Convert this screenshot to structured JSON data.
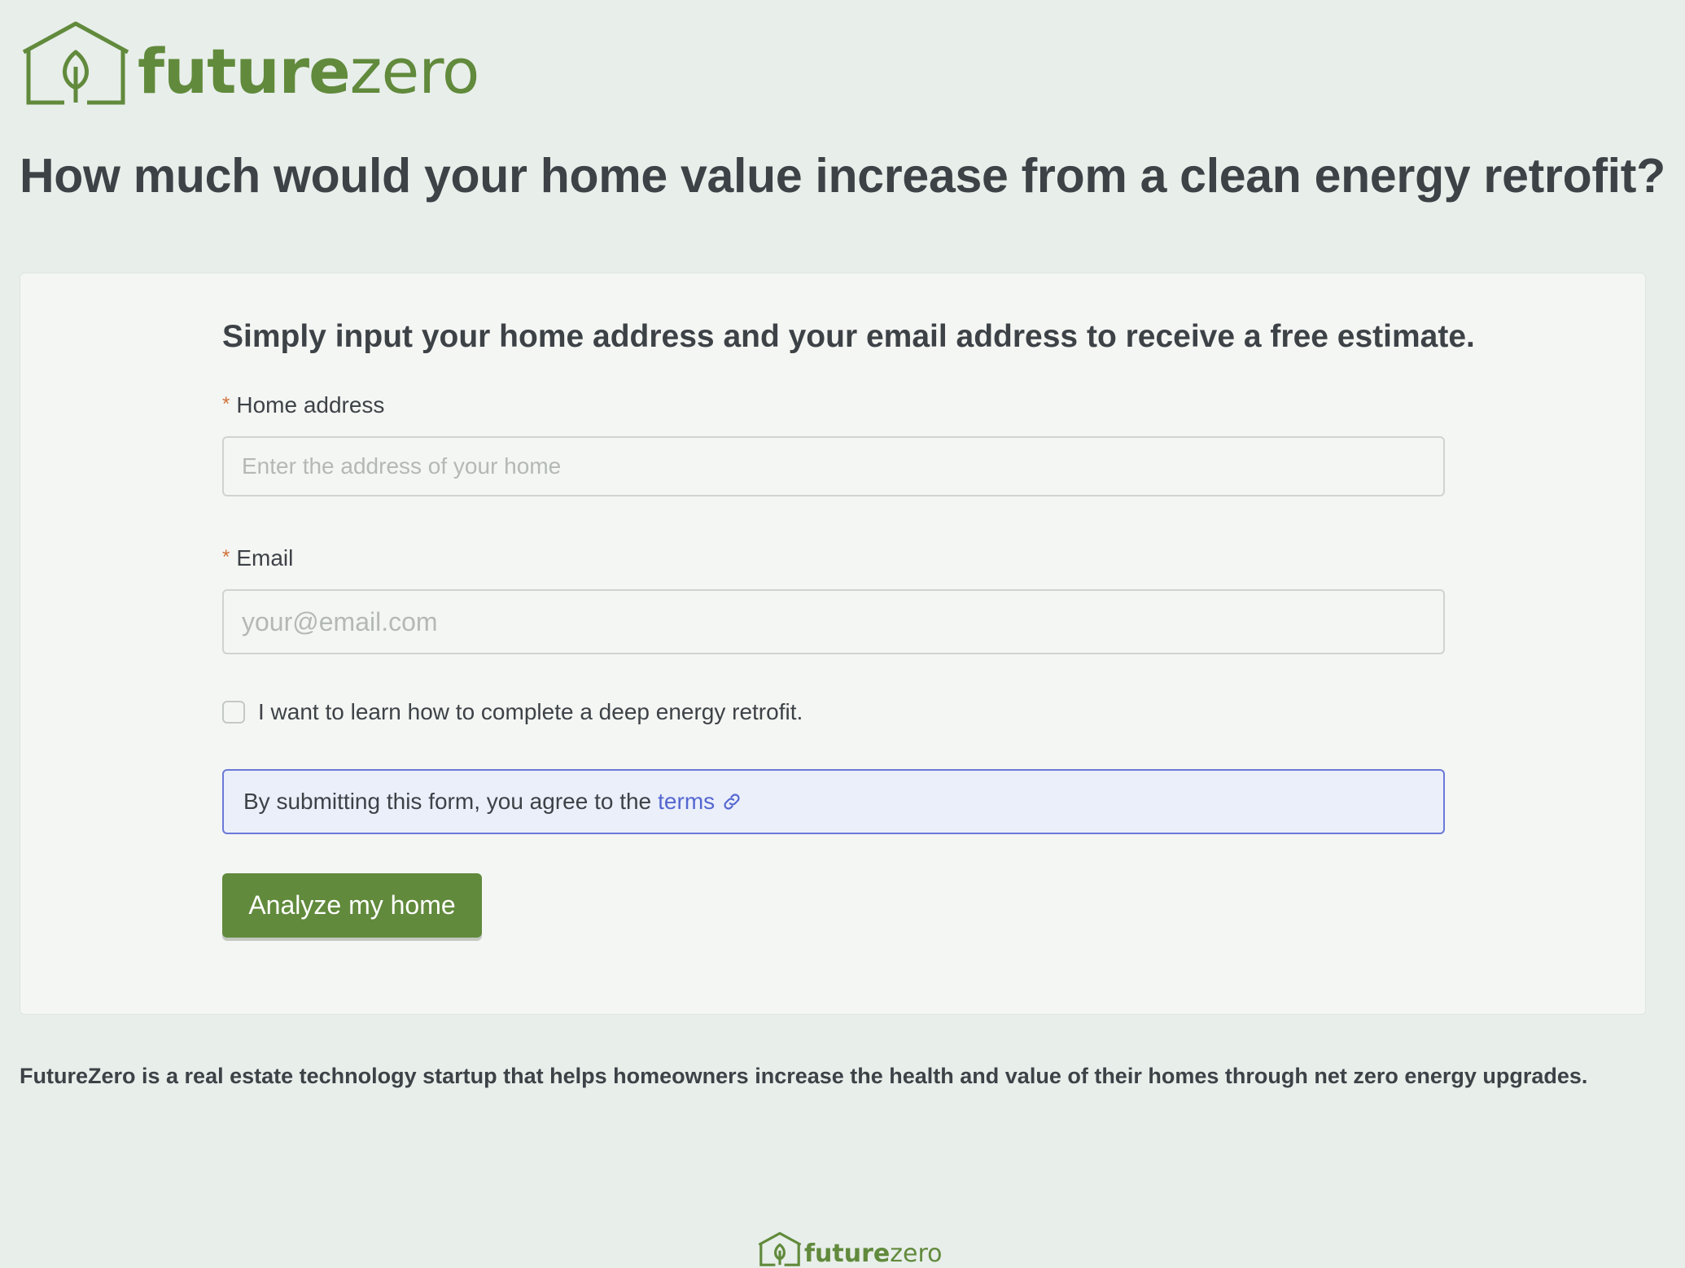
{
  "brand": {
    "name_bold": "future",
    "name_light": "zero",
    "logo_icon": "house-leaf-icon",
    "color": "#618a3c"
  },
  "page": {
    "title": "How much would your home value increase from a clean energy retrofit?"
  },
  "form": {
    "heading": "Simply input your home address and your email address to receive a free estimate.",
    "required_marker": "*",
    "address": {
      "label": "Home address",
      "placeholder": "Enter the address of your home",
      "value": ""
    },
    "email": {
      "label": "Email",
      "placeholder": "your@email.com",
      "value": ""
    },
    "checkbox": {
      "label": "I want to learn how to complete a deep energy retrofit.",
      "checked": false
    },
    "notice": {
      "text": "By submitting this form, you agree to the",
      "link_label": "terms",
      "link_icon": "external-link-icon"
    },
    "submit_label": "Analyze my home"
  },
  "about": {
    "text": "FutureZero is a real estate technology startup that helps homeowners increase the health and value of their homes through net zero energy upgrades."
  },
  "colors": {
    "background": "#e8eeea",
    "card": "#f4f6f3",
    "text": "#3d4247",
    "required": "#d0713a",
    "link": "#5567d0",
    "notice_border": "#6b79d8",
    "notice_background": "#eaeffa"
  }
}
